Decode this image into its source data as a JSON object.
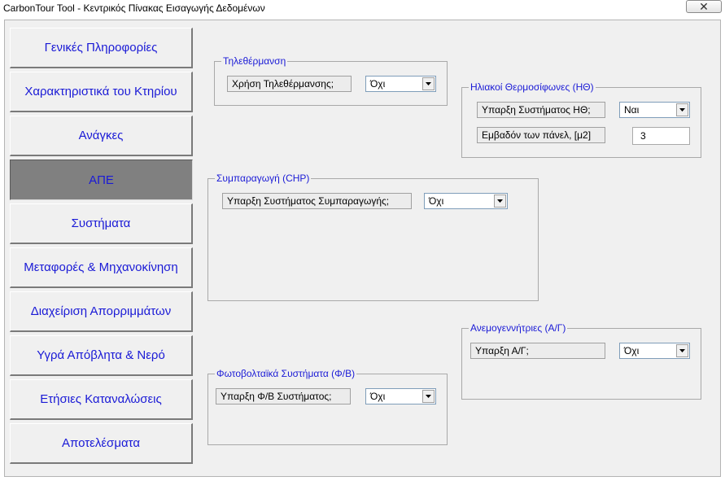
{
  "window": {
    "title": "CarbonTour Tool - Κεντρικός Πίνακας Εισαγωγής Δεδομένων",
    "close_glyph": "✕"
  },
  "nav": {
    "items": [
      {
        "label": "Γενικές Πληροφορίες"
      },
      {
        "label": "Χαρακτηριστικά του Κτηρίου"
      },
      {
        "label": "Ανάγκες"
      },
      {
        "label": "ΑΠΕ"
      },
      {
        "label": "Συστήματα"
      },
      {
        "label": "Μεταφορές & Μηχανοκίνηση"
      },
      {
        "label": "Διαχείριση Απορριμμάτων"
      },
      {
        "label": "Υγρά Απόβλητα & Νερό"
      },
      {
        "label": "Ετήσιες Καταναλώσεις"
      },
      {
        "label": "Αποτελέσματα"
      }
    ],
    "active": "ΑΠΕ"
  },
  "groups": {
    "teleheating": {
      "title": "Τηλεθέρμανση",
      "label": "Χρήση Τηλεθέρμανσης;",
      "value": "Όχι"
    },
    "solar": {
      "title": "Ηλιακοί Θερμοσίφωνες (ΗΘ)",
      "exists_label": "Υπαρξη Συστήματος ΗΘ;",
      "exists_value": "Ναι",
      "area_label": "Εμβαδόν των πάνελ, [μ2]",
      "area_value": "3"
    },
    "chp": {
      "title": "Συμπαραγωγή (CHP)",
      "label": "Υπαρξη Συστήματος Συμπαραγωγής;",
      "value": "Όχι"
    },
    "wind": {
      "title": "Ανεμογεννήτριες (Α/Γ)",
      "label": "Υπαρξη Α/Γ;",
      "value": "Όχι"
    },
    "pv": {
      "title": "Φωτοβολταϊκά Συστήματα (Φ/Β)",
      "label": "Υπαρξη Φ/Β Συστήματος;",
      "value": "Όχι"
    }
  },
  "colors": {
    "accent_text": "#1a1ad6",
    "active_nav_bg": "#808080",
    "form_bg": "#f0f0f0"
  },
  "icons": {
    "dropdown": "chevron-down-icon",
    "close": "close-icon"
  }
}
